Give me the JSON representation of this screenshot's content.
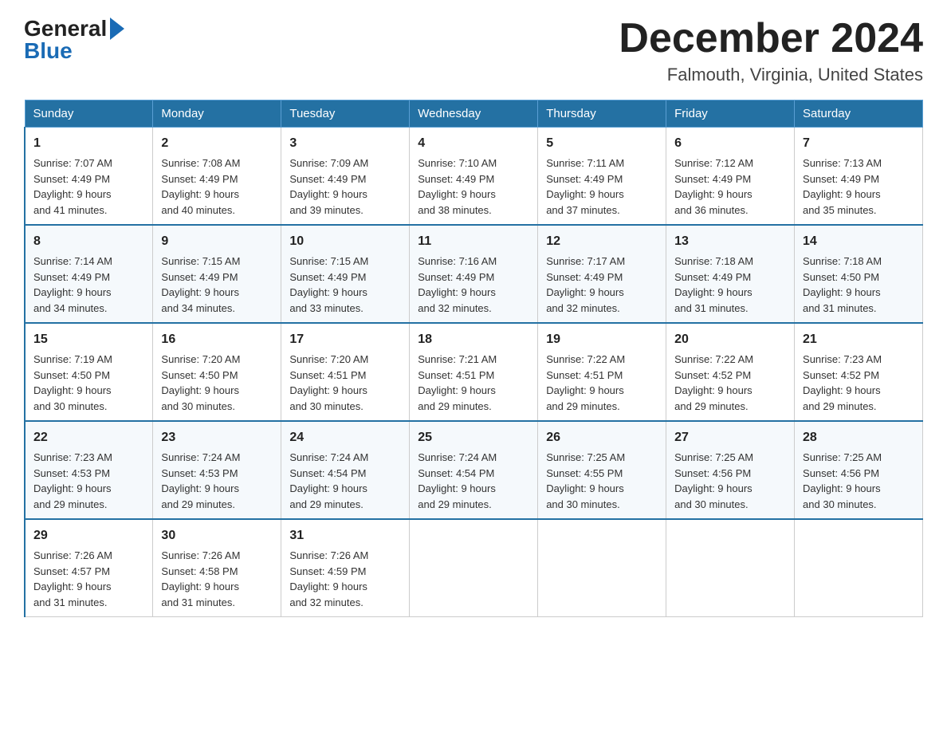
{
  "header": {
    "logo_general": "General",
    "logo_blue": "Blue",
    "month_title": "December 2024",
    "location": "Falmouth, Virginia, United States"
  },
  "calendar": {
    "days_of_week": [
      "Sunday",
      "Monday",
      "Tuesday",
      "Wednesday",
      "Thursday",
      "Friday",
      "Saturday"
    ],
    "weeks": [
      [
        {
          "day": "1",
          "sunrise": "7:07 AM",
          "sunset": "4:49 PM",
          "daylight": "9 hours and 41 minutes."
        },
        {
          "day": "2",
          "sunrise": "7:08 AM",
          "sunset": "4:49 PM",
          "daylight": "9 hours and 40 minutes."
        },
        {
          "day": "3",
          "sunrise": "7:09 AM",
          "sunset": "4:49 PM",
          "daylight": "9 hours and 39 minutes."
        },
        {
          "day": "4",
          "sunrise": "7:10 AM",
          "sunset": "4:49 PM",
          "daylight": "9 hours and 38 minutes."
        },
        {
          "day": "5",
          "sunrise": "7:11 AM",
          "sunset": "4:49 PM",
          "daylight": "9 hours and 37 minutes."
        },
        {
          "day": "6",
          "sunrise": "7:12 AM",
          "sunset": "4:49 PM",
          "daylight": "9 hours and 36 minutes."
        },
        {
          "day": "7",
          "sunrise": "7:13 AM",
          "sunset": "4:49 PM",
          "daylight": "9 hours and 35 minutes."
        }
      ],
      [
        {
          "day": "8",
          "sunrise": "7:14 AM",
          "sunset": "4:49 PM",
          "daylight": "9 hours and 34 minutes."
        },
        {
          "day": "9",
          "sunrise": "7:15 AM",
          "sunset": "4:49 PM",
          "daylight": "9 hours and 34 minutes."
        },
        {
          "day": "10",
          "sunrise": "7:15 AM",
          "sunset": "4:49 PM",
          "daylight": "9 hours and 33 minutes."
        },
        {
          "day": "11",
          "sunrise": "7:16 AM",
          "sunset": "4:49 PM",
          "daylight": "9 hours and 32 minutes."
        },
        {
          "day": "12",
          "sunrise": "7:17 AM",
          "sunset": "4:49 PM",
          "daylight": "9 hours and 32 minutes."
        },
        {
          "day": "13",
          "sunrise": "7:18 AM",
          "sunset": "4:49 PM",
          "daylight": "9 hours and 31 minutes."
        },
        {
          "day": "14",
          "sunrise": "7:18 AM",
          "sunset": "4:50 PM",
          "daylight": "9 hours and 31 minutes."
        }
      ],
      [
        {
          "day": "15",
          "sunrise": "7:19 AM",
          "sunset": "4:50 PM",
          "daylight": "9 hours and 30 minutes."
        },
        {
          "day": "16",
          "sunrise": "7:20 AM",
          "sunset": "4:50 PM",
          "daylight": "9 hours and 30 minutes."
        },
        {
          "day": "17",
          "sunrise": "7:20 AM",
          "sunset": "4:51 PM",
          "daylight": "9 hours and 30 minutes."
        },
        {
          "day": "18",
          "sunrise": "7:21 AM",
          "sunset": "4:51 PM",
          "daylight": "9 hours and 29 minutes."
        },
        {
          "day": "19",
          "sunrise": "7:22 AM",
          "sunset": "4:51 PM",
          "daylight": "9 hours and 29 minutes."
        },
        {
          "day": "20",
          "sunrise": "7:22 AM",
          "sunset": "4:52 PM",
          "daylight": "9 hours and 29 minutes."
        },
        {
          "day": "21",
          "sunrise": "7:23 AM",
          "sunset": "4:52 PM",
          "daylight": "9 hours and 29 minutes."
        }
      ],
      [
        {
          "day": "22",
          "sunrise": "7:23 AM",
          "sunset": "4:53 PM",
          "daylight": "9 hours and 29 minutes."
        },
        {
          "day": "23",
          "sunrise": "7:24 AM",
          "sunset": "4:53 PM",
          "daylight": "9 hours and 29 minutes."
        },
        {
          "day": "24",
          "sunrise": "7:24 AM",
          "sunset": "4:54 PM",
          "daylight": "9 hours and 29 minutes."
        },
        {
          "day": "25",
          "sunrise": "7:24 AM",
          "sunset": "4:54 PM",
          "daylight": "9 hours and 29 minutes."
        },
        {
          "day": "26",
          "sunrise": "7:25 AM",
          "sunset": "4:55 PM",
          "daylight": "9 hours and 30 minutes."
        },
        {
          "day": "27",
          "sunrise": "7:25 AM",
          "sunset": "4:56 PM",
          "daylight": "9 hours and 30 minutes."
        },
        {
          "day": "28",
          "sunrise": "7:25 AM",
          "sunset": "4:56 PM",
          "daylight": "9 hours and 30 minutes."
        }
      ],
      [
        {
          "day": "29",
          "sunrise": "7:26 AM",
          "sunset": "4:57 PM",
          "daylight": "9 hours and 31 minutes."
        },
        {
          "day": "30",
          "sunrise": "7:26 AM",
          "sunset": "4:58 PM",
          "daylight": "9 hours and 31 minutes."
        },
        {
          "day": "31",
          "sunrise": "7:26 AM",
          "sunset": "4:59 PM",
          "daylight": "9 hours and 32 minutes."
        },
        null,
        null,
        null,
        null
      ]
    ],
    "labels": {
      "sunrise": "Sunrise: ",
      "sunset": "Sunset: ",
      "daylight": "Daylight: "
    }
  }
}
